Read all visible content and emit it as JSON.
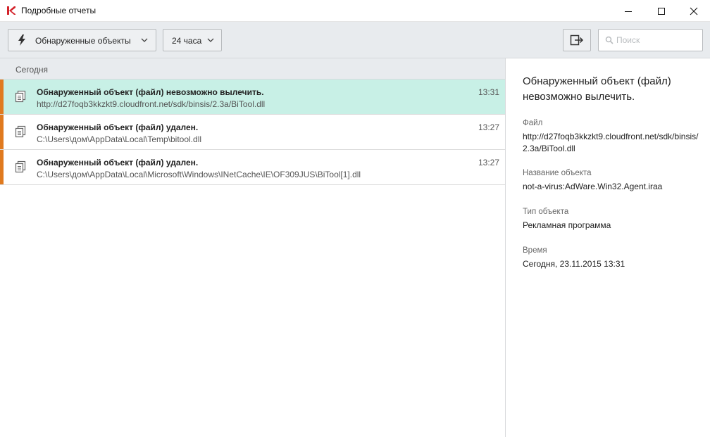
{
  "window": {
    "title": "Подробные отчеты"
  },
  "toolbar": {
    "filter_label": "Обнаруженные объекты",
    "period_label": "24 часа",
    "search_placeholder": "Поиск"
  },
  "list": {
    "group_header": "Сегодня",
    "rows": [
      {
        "title": "Обнаруженный объект (файл) невозможно вылечить.",
        "path": "http://d27foqb3kkzkt9.cloudfront.net/sdk/binsis/2.3a/BiTool.dll",
        "time": "13:31"
      },
      {
        "title": "Обнаруженный объект (файл) удален.",
        "path": "C:\\Users\\дом\\AppData\\Local\\Temp\\bitool.dll",
        "time": "13:27"
      },
      {
        "title": "Обнаруженный объект (файл) удален.",
        "path": "C:\\Users\\дом\\AppData\\Local\\Microsoft\\Windows\\INetCache\\IE\\OF309JUS\\BiTool[1].dll",
        "time": "13:27"
      }
    ]
  },
  "detail": {
    "title": "Обнаруженный объект (файл) невозможно вылечить.",
    "file_label": "Файл",
    "file_value": "http://d27foqb3kkzkt9.cloudfront.net/sdk/binsis/2.3a/BiTool.dll",
    "name_label": "Название объекта",
    "name_value": "not-a-virus:AdWare.Win32.Agent.iraa",
    "type_label": "Тип объекта",
    "type_value": "Рекламная программа",
    "time_label": "Время",
    "time_value": "Сегодня, 23.11.2015 13:31"
  },
  "colors": {
    "accent_orange": "#e07a1f",
    "selected_row": "#c8f0e6",
    "logo_red": "#d3222a"
  },
  "icons": {
    "logo": "kaspersky-k-logo",
    "filter": "lightning-bolt-icon",
    "dropdown": "chevron-down-icon",
    "export": "export-icon",
    "search": "search-icon",
    "row": "documents-icon"
  }
}
